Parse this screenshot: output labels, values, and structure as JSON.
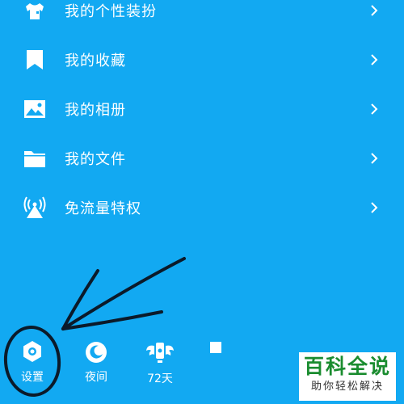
{
  "menu": {
    "items": [
      {
        "label": "我的个性装扮",
        "icon": "tshirt-icon"
      },
      {
        "label": "我的收藏",
        "icon": "bookmark-icon"
      },
      {
        "label": "我的相册",
        "icon": "photo-icon"
      },
      {
        "label": "我的文件",
        "icon": "folder-icon"
      },
      {
        "label": "免流量特权",
        "icon": "signal-tower-icon"
      }
    ]
  },
  "bottom_bar": {
    "settings_label": "设置",
    "night_label": "夜间",
    "days_label": "72天"
  },
  "watermark": {
    "main": "百科全说",
    "sub": "助你轻松解决"
  },
  "colors": {
    "background": "#12a9f2",
    "foreground": "#ffffff",
    "annotation": "#0b1a2a",
    "watermark_text": "#1a8c2f"
  }
}
